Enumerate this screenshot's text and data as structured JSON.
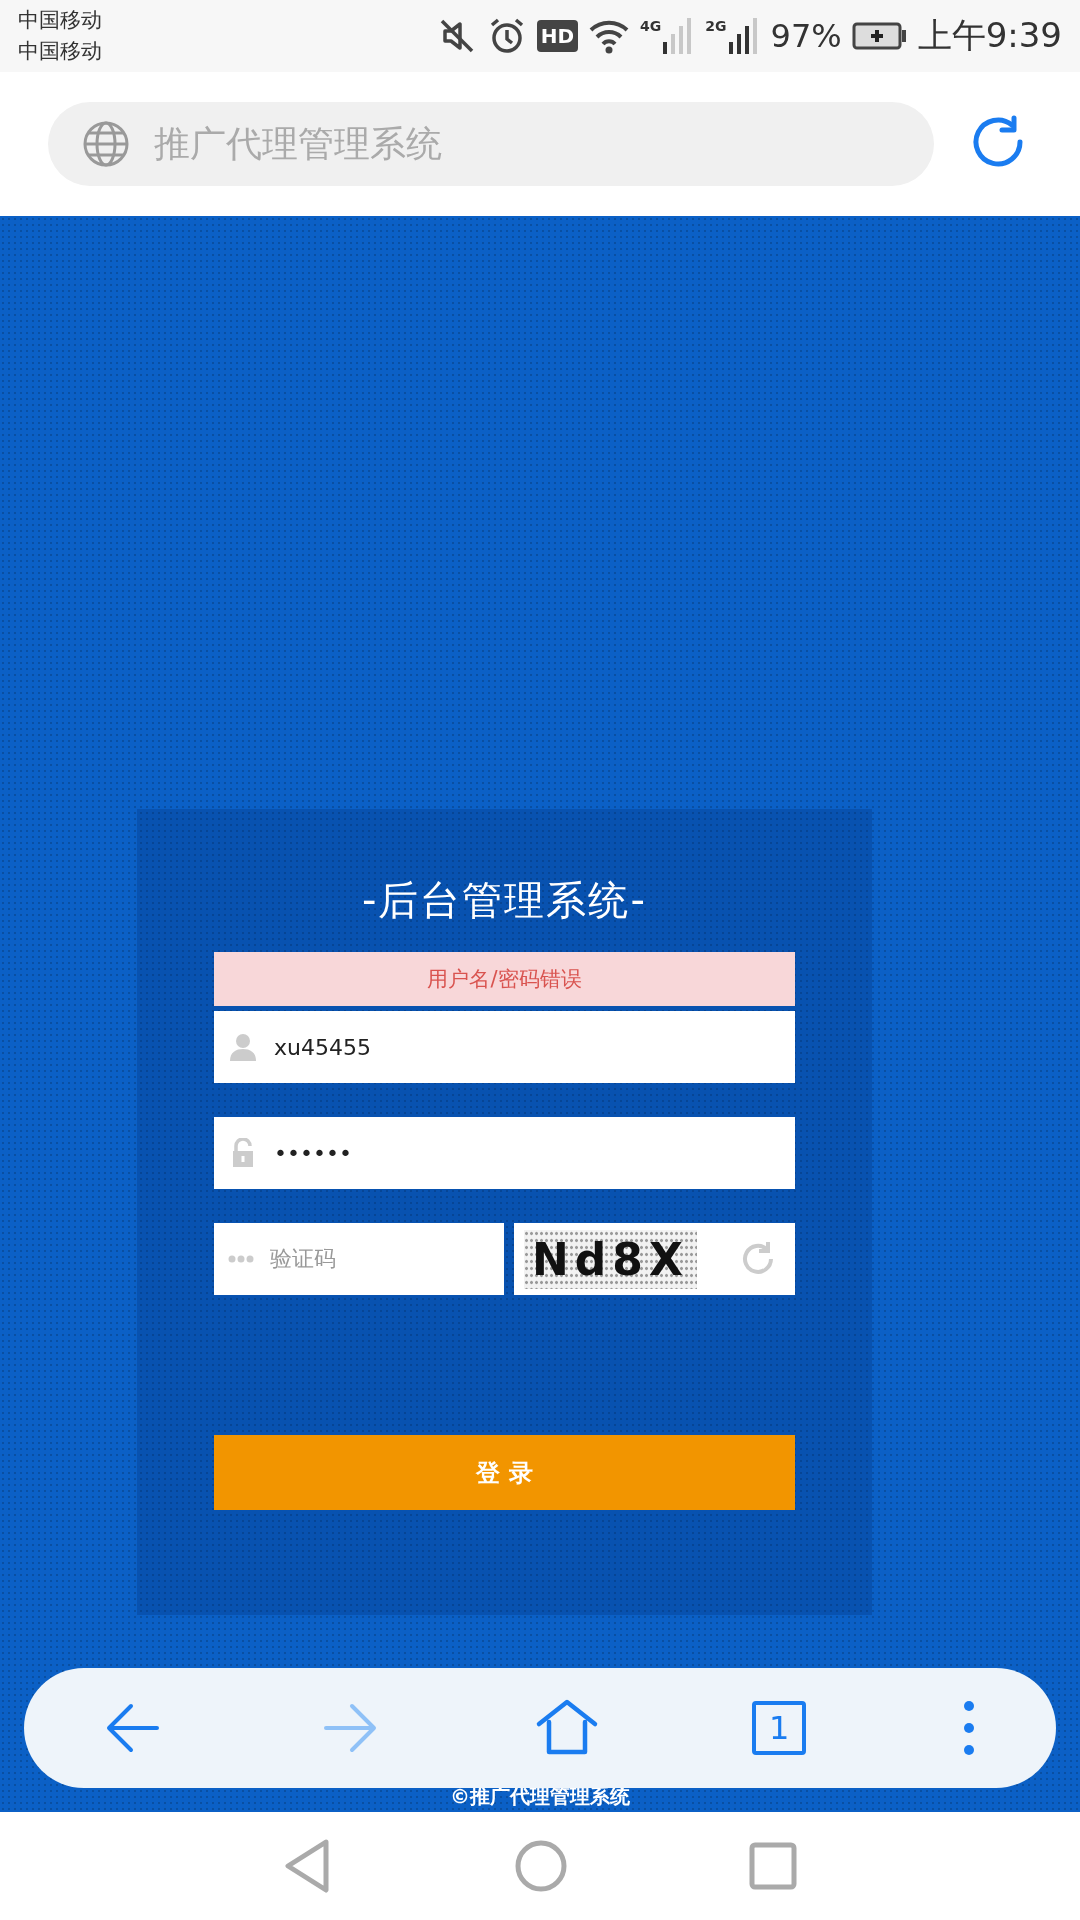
{
  "status_bar": {
    "carriers": [
      "中国移动",
      "中国移动"
    ],
    "hd_badge": "HD",
    "networks": [
      {
        "label": "4G"
      },
      {
        "label": "2G"
      }
    ],
    "battery": "97%",
    "time": "上午9:39"
  },
  "address_bar": {
    "title": "推广代理管理系统"
  },
  "login": {
    "title": "-后台管理系统-",
    "error": "用户名/密码错误",
    "username": {
      "value": "xu45455"
    },
    "password": {
      "value": "••••••"
    },
    "captcha": {
      "placeholder": "验证码",
      "code": "Nd8X"
    },
    "submit": "登 录"
  },
  "browser_toolbar": {
    "back_enabled": true,
    "forward_enabled": false,
    "tab_count": "1"
  },
  "footer": "©推广代理管理系统"
}
